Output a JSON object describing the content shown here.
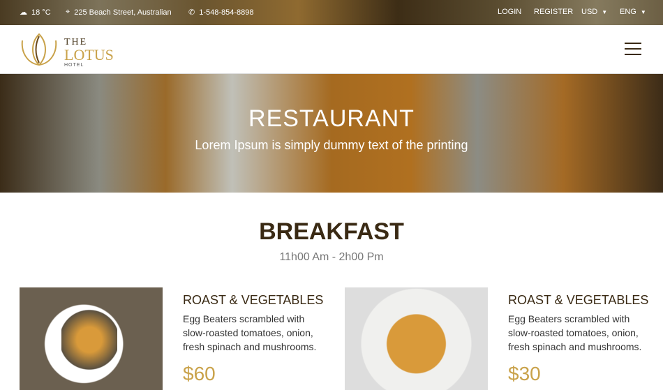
{
  "topbar": {
    "weather": "18 °C",
    "address": "225 Beach Street, Australian",
    "phone": "1-548-854-8898",
    "login": "LOGIN",
    "register": "REGISTER",
    "currency": "USD",
    "language": "ENG"
  },
  "logo": {
    "the": "THE",
    "lotus": "LOTUS",
    "hotel": "HOTEL"
  },
  "hero": {
    "title": "RESTAURANT",
    "subtitle": "Lorem Ipsum is simply dummy text of the printing"
  },
  "section": {
    "title": "BREAKFAST",
    "hours": "11h00 Am - 2h00 Pm"
  },
  "items": [
    {
      "title": "ROAST & VEGETABLES",
      "desc": "Egg Beaters scrambled with slow-roasted tomatoes, onion, fresh spinach and mushrooms.",
      "price": "$60"
    },
    {
      "title": "ROAST & VEGETABLES",
      "desc": "Egg Beaters scrambled with slow-roasted tomatoes, onion, fresh spinach and mushrooms.",
      "price": "$30"
    }
  ],
  "colors": {
    "accent": "#c9a24a",
    "dark": "#3a2a14"
  }
}
